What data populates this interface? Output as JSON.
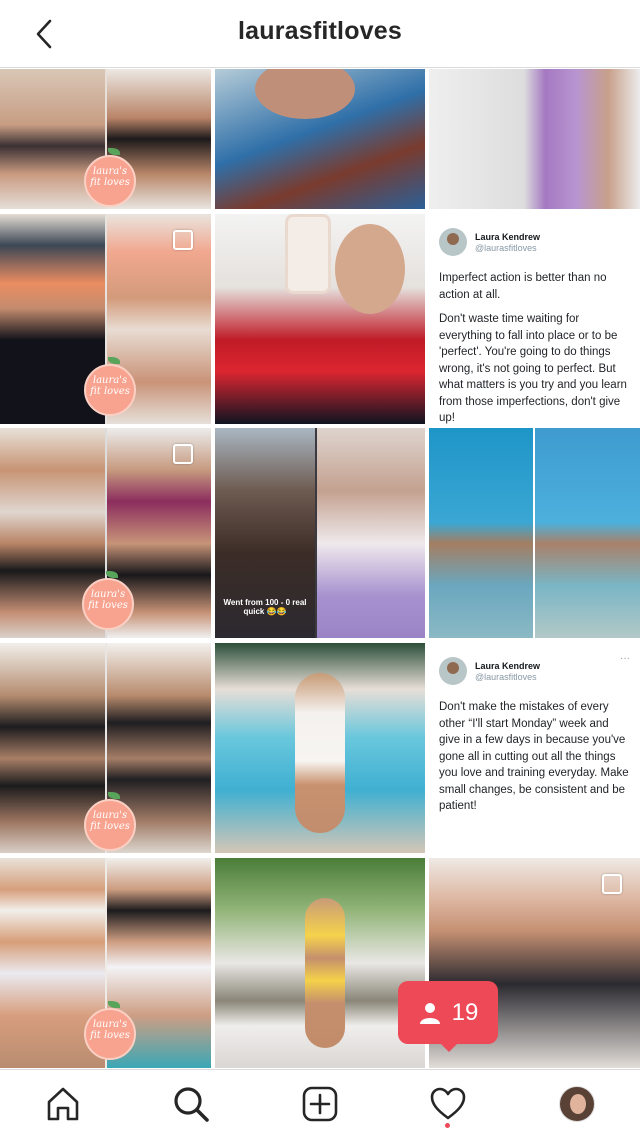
{
  "header": {
    "title": "laurasfitloves",
    "back_icon": "chevron-left-icon"
  },
  "logo_text": "laura's fit loves",
  "tweets": [
    {
      "name": "Laura Kendrew",
      "handle": "@laurasfitloves",
      "paragraphs": [
        "Imperfect action is better than no action at all.",
        "Don't waste time waiting for everything to fall into place or to be 'perfect'. You're going to do things wrong, it's not going to perfect. But what matters is you try and you learn from those imperfections, don't give up!"
      ]
    },
    {
      "name": "Laura Kendrew",
      "handle": "@laurasfitloves",
      "paragraphs": [
        "Don't make the mistakes of every other “I'll start Monday” week and give in a few days in because you've gone all in cutting out all the things you love and training everyday. Make small changes, be consistent and be patient!"
      ]
    }
  ],
  "story_caption": "Went from 100 - 0 real quick 😂😂",
  "notification": {
    "icon": "person-icon",
    "count": "19"
  },
  "bottom_nav": {
    "items": [
      "home-icon",
      "search-icon",
      "add-post-icon",
      "activity-heart-icon",
      "profile-avatar"
    ]
  },
  "colors": {
    "notification_red": "#ed4956",
    "border": "#dbdbdb",
    "text": "#262626"
  }
}
